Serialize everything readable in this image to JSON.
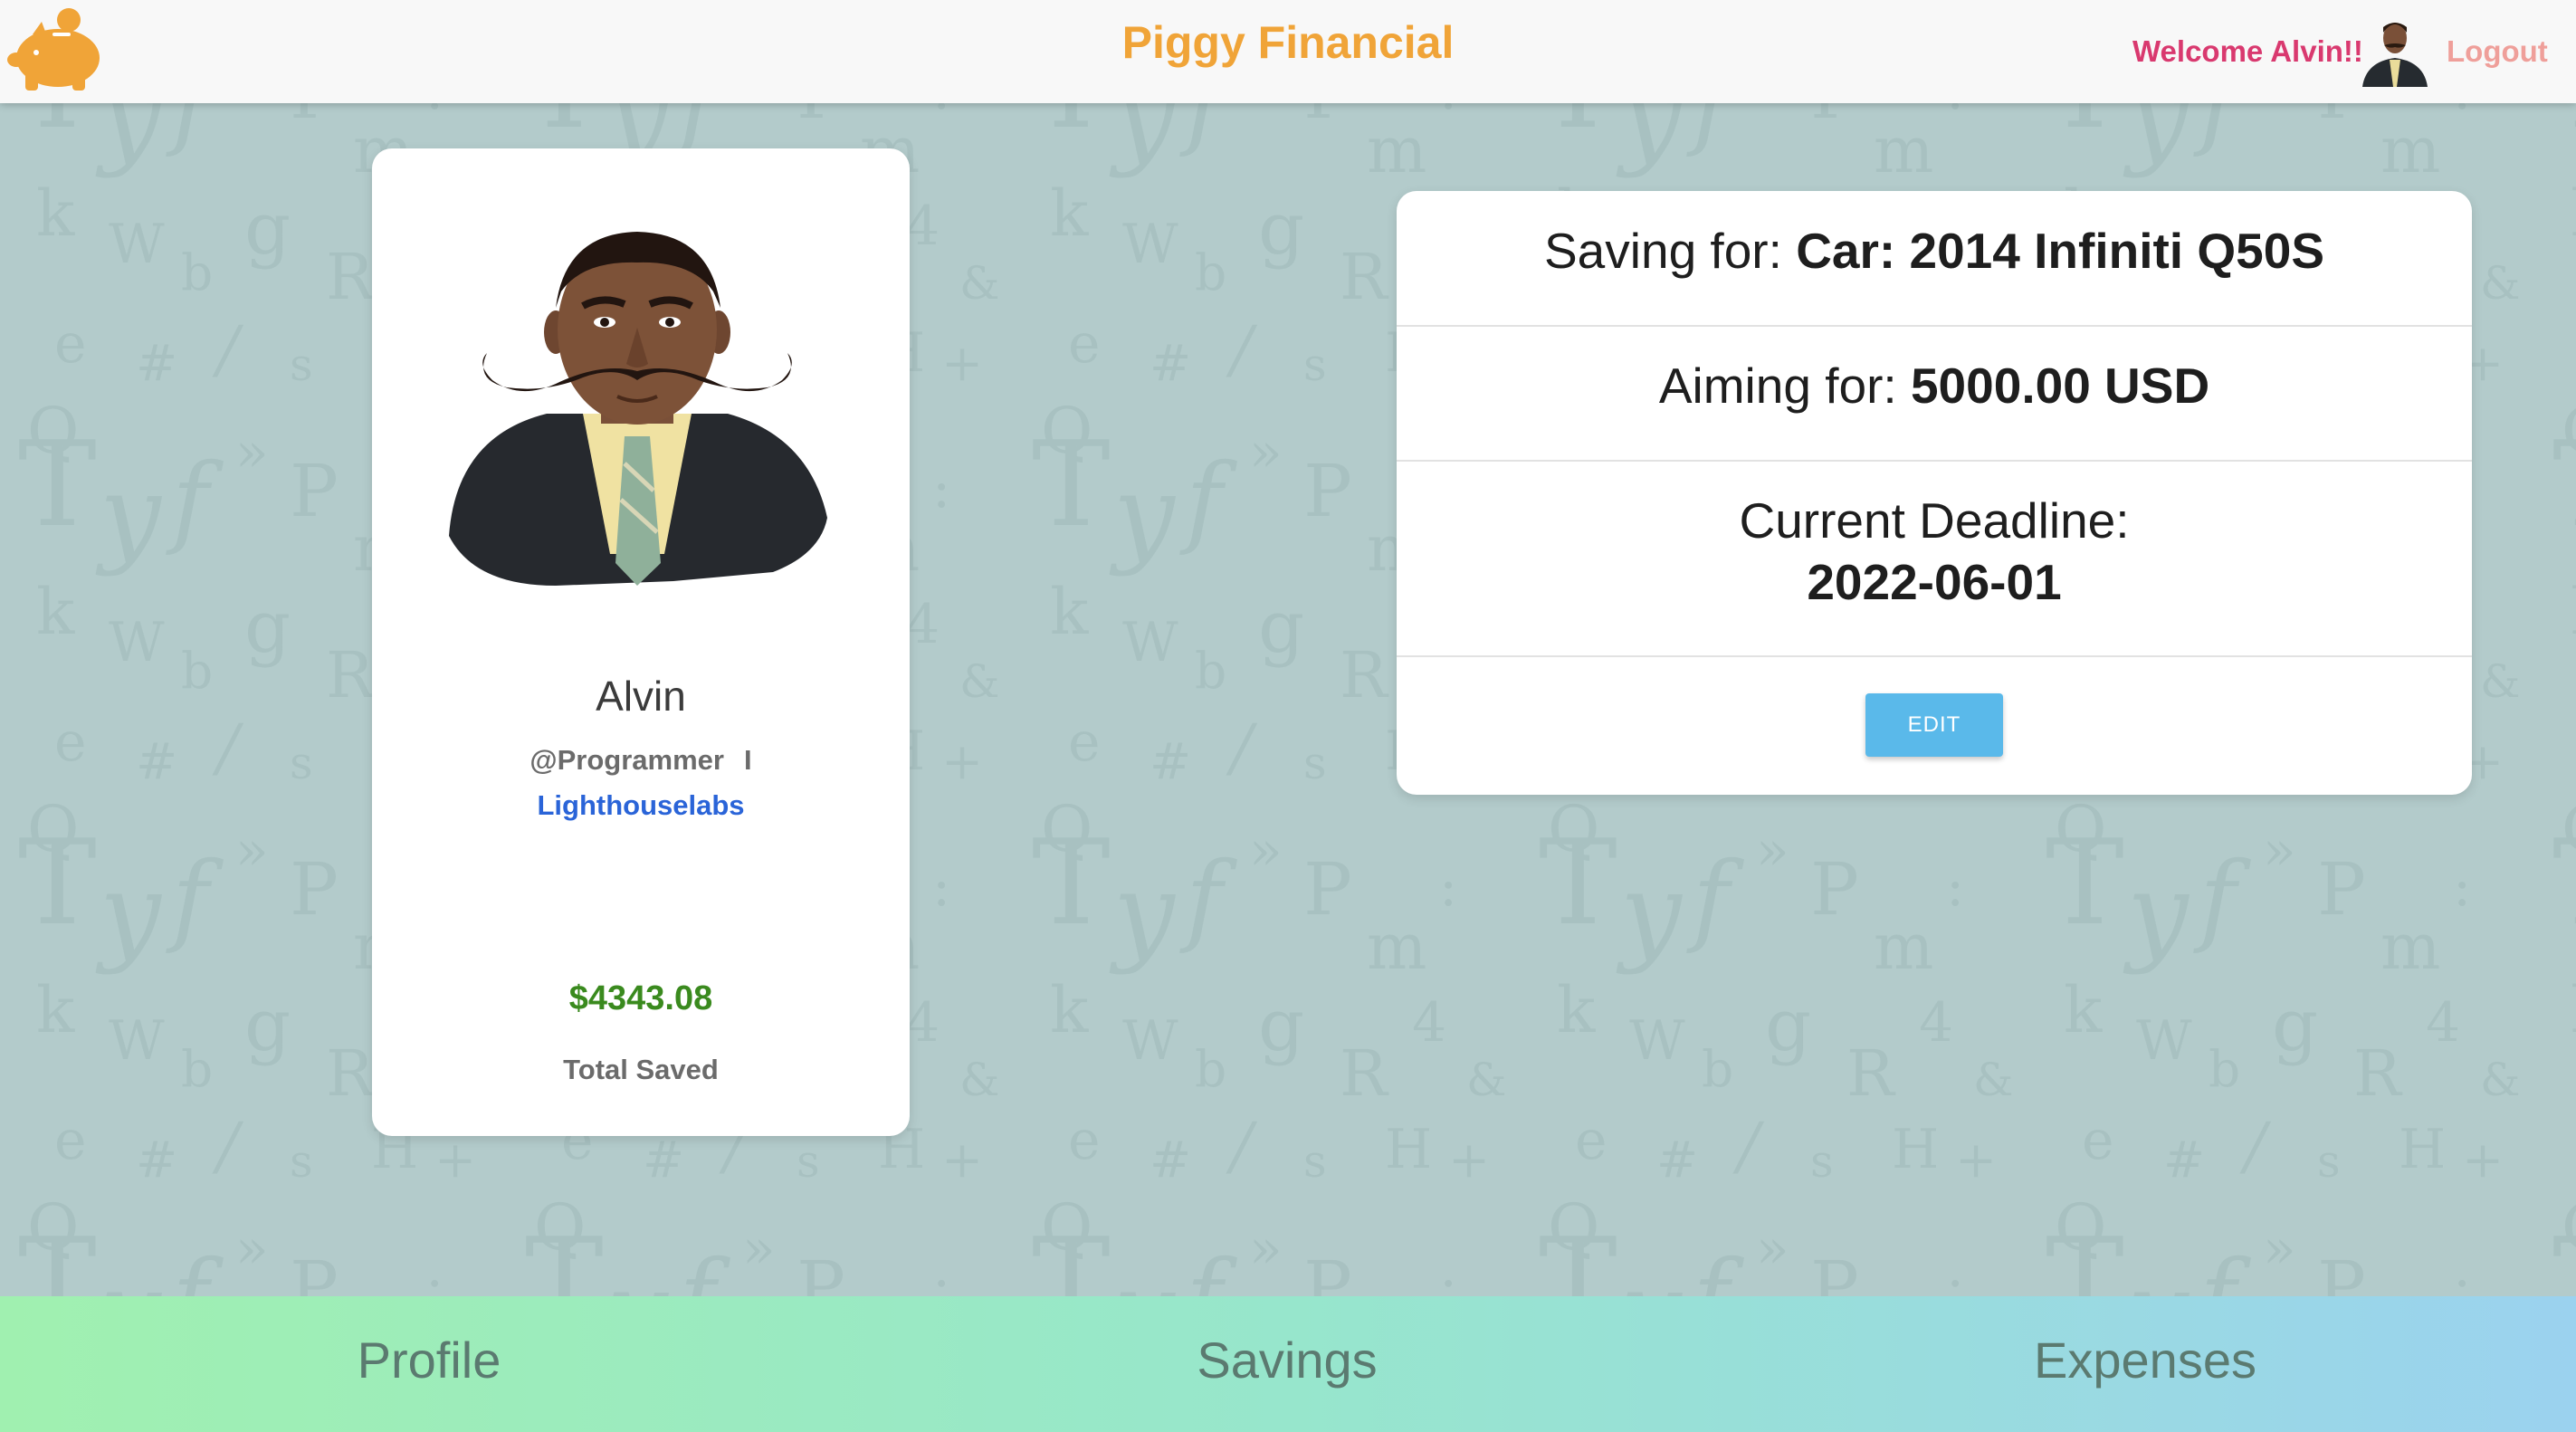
{
  "header": {
    "brand_title": "Piggy Financial",
    "welcome_text": "Welcome Alvin!!",
    "logout_label": "Logout",
    "brand_color": "#f0a438",
    "logo_icon": "piggy-bank-icon"
  },
  "profile": {
    "name": "Alvin",
    "role": "@Programmer",
    "separator": "I",
    "company": "Lighthouselabs",
    "total_amount": "$4343.08",
    "total_label": "Total Saved"
  },
  "goal": {
    "saving_label": "Saving for:",
    "saving_value": "Car: 2014 Infiniti Q50S",
    "aiming_label": "Aiming for:",
    "aiming_value": "5000.00 USD",
    "deadline_label": "Current Deadline:",
    "deadline_value": "2022-06-01",
    "edit_label": "EDIT"
  },
  "bottom_nav": {
    "tabs": [
      {
        "label": "Profile"
      },
      {
        "label": "Savings"
      },
      {
        "label": "Expenses"
      }
    ]
  },
  "colors": {
    "background": "#b3cbcb",
    "welcome": "#d9396f",
    "logout": "#ef9f9a",
    "total": "#3a8a1e",
    "company_link": "#2a64d8",
    "edit_button": "#5ab9ea"
  }
}
